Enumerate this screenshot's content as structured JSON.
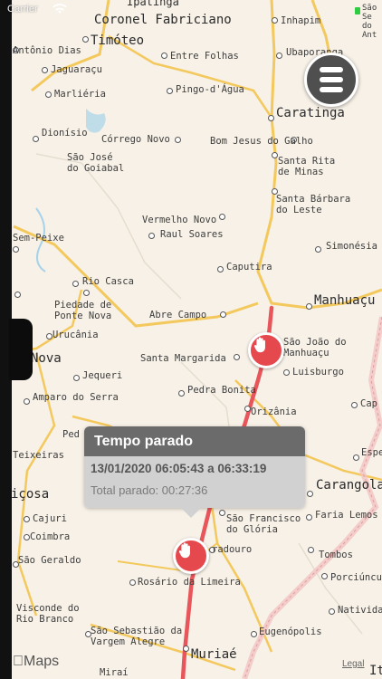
{
  "status_bar": {
    "carrier": "Carrier"
  },
  "map": {
    "labels": {
      "ipatinga": "Ipatinga",
      "coronel_fabriciano": "Coronel Fabriciano",
      "inhapim": "Inhapim",
      "sao_do_ant": "São Se do Ant",
      "antonio_dias": "Antônio Dias",
      "timoteo": "Timóteo",
      "entre_folhas": "Entre Folhas",
      "ubaporanga": "Ubaporanga",
      "jaguaracu": "Jaguaraçu",
      "marlieria": "Marliéria",
      "pingo_dagua": "Pingo-d'Água",
      "caratinga": "Caratinga",
      "dionisio": "Dionísio",
      "corrego_novo": "Córrego Novo",
      "bom_jesus": "Bom Jesus do Galho",
      "sao_jose_1": "São José",
      "sao_jose_2": "do Goiabal",
      "santa_rita_1": "Santa Rita",
      "santa_rita_2": "de Minas",
      "santa_barbara_1": "Santa Bárbara",
      "santa_barbara_2": "do Leste",
      "vermelho_novo": "Vermelho Novo",
      "raul_soares": "Raul Soares",
      "sem_peixe": "Sem-Peixe",
      "simonesia": "Simonésia",
      "caputira": "Caputira",
      "rio_casca": "Rio Casca",
      "piedade_1": "Piedade de",
      "piedade_2": "Ponte Nova",
      "abre_campo": "Abre Campo",
      "manhuacu": "Manhuaçu",
      "urucania": "Urucânia",
      "nova": "Nova",
      "santa_margarida": "Santa Margarida",
      "sao_joao_1": "São João do",
      "sao_joao_2": "Manhuaçu",
      "jequeri": "Jequeri",
      "luisburgo": "Luisburgo",
      "pedra_bonita": "Pedra Bonita",
      "amparo": "Amparo do Serra",
      "orizania": "Orizânia",
      "cap": "Cap",
      "ped": "Ped",
      "teixeiras": "Teixeiras",
      "espe": "Espe",
      "coimbra": "Coimbra",
      "carangola": "Carangola",
      "icosa": "içosa",
      "cajuri": "Cajuri",
      "sao_francisco_1": "São Francisco",
      "sao_francisco_2": "do Glória",
      "faria_lemos": "Faria Lemos",
      "sao_geraldo": "São Geraldo",
      "divino": "radouro",
      "tombos": "Tombos",
      "rosario": "Rosário da Limeira",
      "porciuncula": "Porciúncula",
      "visconde_1": "Visconde do",
      "visconde_2": "Rio Branco",
      "natividade": "Natividad",
      "sao_sebastiao_1": "São Sebastião da",
      "sao_sebastiao_2": "Vargem Alegre",
      "eugenopolis": "Eugenópolis",
      "mirai": "Miraí",
      "muriae": "Muriaé",
      "ita": "Ita"
    },
    "attribution": "Maps",
    "legal": "Legal"
  },
  "callout": {
    "title": "Tempo parado",
    "range": "13/01/2020 06:05:43 a 06:33:19",
    "total": "Total parado: 00:27:36"
  },
  "icons": {
    "menu": "hamburger-icon",
    "stop_pin": "hand-stop-icon",
    "wifi": "wifi-icon"
  },
  "colors": {
    "route": "#e8555a",
    "pin": "#e5484d",
    "menu_button": "#4f4f4f",
    "callout_header": "#6b6b6b",
    "callout_body": "#d1d1d1",
    "highway": "#f3c85c"
  }
}
